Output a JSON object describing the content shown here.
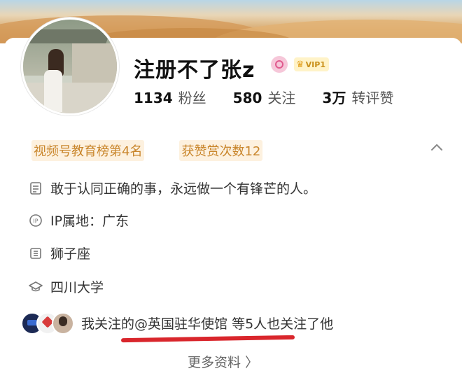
{
  "profile": {
    "name": "注册不了张z",
    "vip_label": "VIP1",
    "stats": [
      {
        "value": "1134",
        "label": "粉丝"
      },
      {
        "value": "580",
        "label": "关注"
      },
      {
        "value": "3万",
        "label": "转评赞"
      }
    ]
  },
  "tags": [
    "视频号教育榜第4名",
    "获赞赏次数12"
  ],
  "info": {
    "bio": "敢于认同正确的事，永远做一个有锋芒的人。",
    "ip": "IP属地：广东",
    "zodiac": "狮子座",
    "school": "四川大学"
  },
  "follow_note": {
    "prefix": "我关注的",
    "mention": "@英国驻华使馆",
    "suffix": " 等5人也关注了他"
  },
  "more_label": "更多资料 〉",
  "colors": {
    "tag_text": "#c9862c",
    "underline": "#d9262c",
    "vip_gold": "#c9901a"
  }
}
